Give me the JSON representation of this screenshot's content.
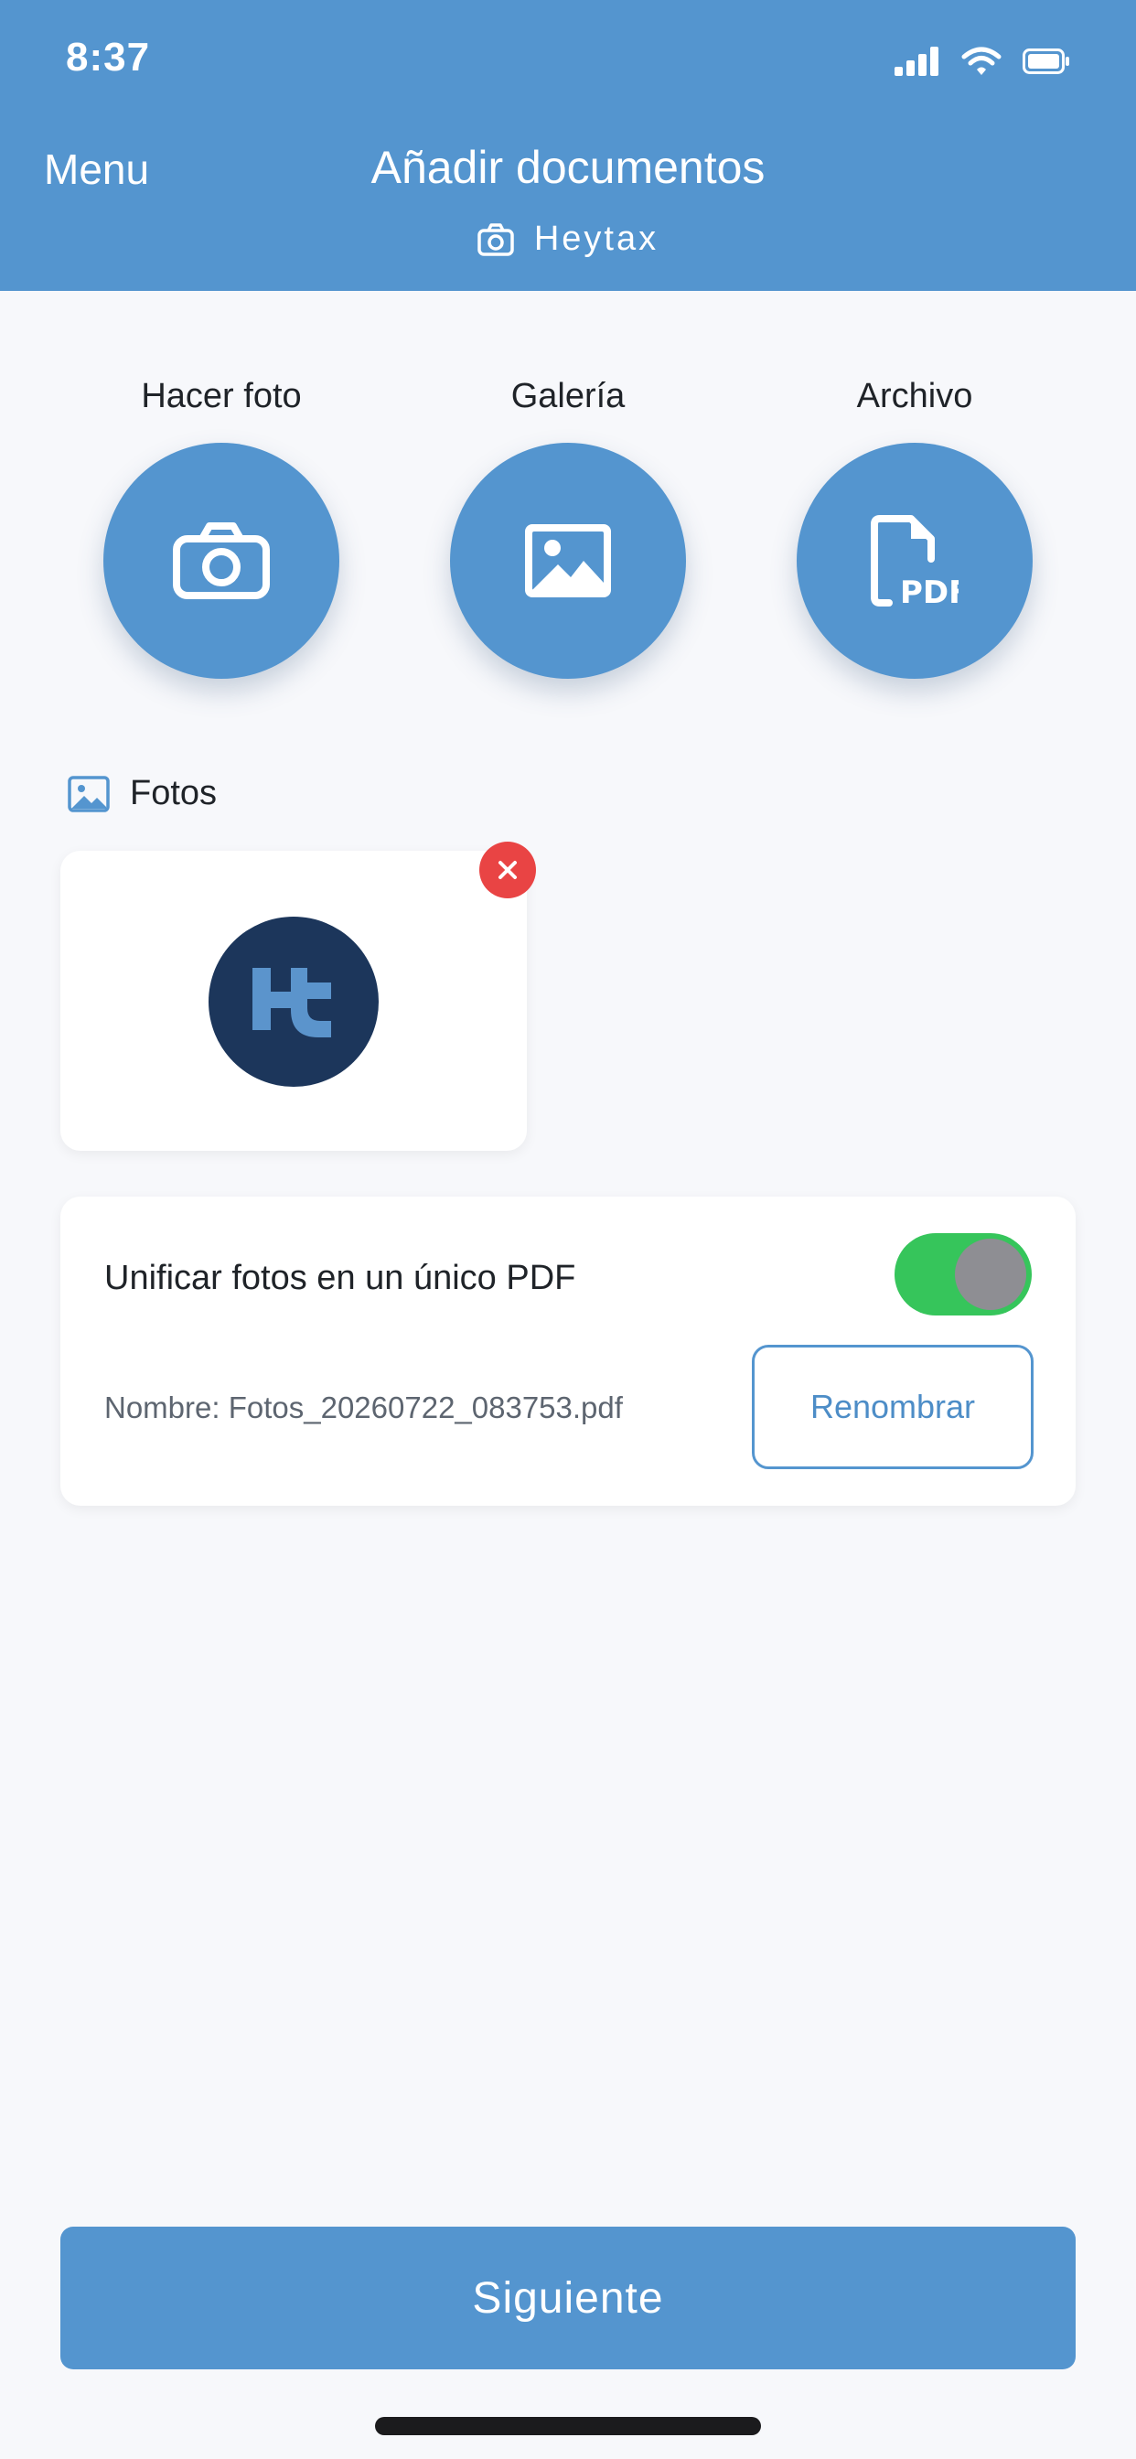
{
  "status_bar": {
    "time": "8:37",
    "icons": [
      "cellular-signal-icon",
      "wifi-icon",
      "battery-icon"
    ]
  },
  "nav": {
    "menu_label": "Menu",
    "title": "Añadir documentos",
    "subtitle": "Heytax",
    "subtitle_icon": "camera-icon"
  },
  "actions": [
    {
      "label": "Hacer foto",
      "icon": "camera-icon"
    },
    {
      "label": "Galería",
      "icon": "image-icon"
    },
    {
      "label": "Archivo",
      "icon": "pdf-file-icon"
    }
  ],
  "photos": {
    "section_title": "Fotos",
    "section_icon": "image-icon",
    "items": [
      {
        "thumbnail": "heytax-logo"
      }
    ]
  },
  "pdf_options": {
    "unify_label": "Unificar fotos en un único PDF",
    "unify_enabled": true,
    "name_text": "Nombre: Fotos_20260722_083753.pdf",
    "rename_label": "Renombrar"
  },
  "footer": {
    "next_label": "Siguiente"
  },
  "colors": {
    "primary": "#5495cf",
    "background": "#f7f8fb",
    "toggle_on": "#36c55b",
    "remove": "#e94444",
    "logo_bg": "#1c365b"
  }
}
